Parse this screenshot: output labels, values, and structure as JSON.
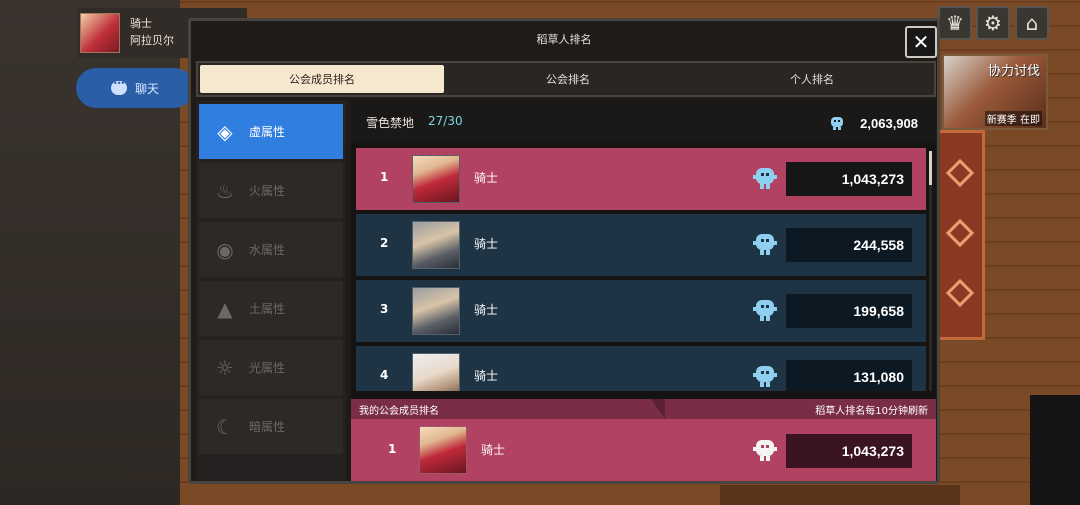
{
  "player": {
    "name": "骑士",
    "guild": "阿拉贝尔"
  },
  "chat": {
    "label": "聊天"
  },
  "event": {
    "title": "协力讨伐",
    "subtitle": "新赛季 在即"
  },
  "modal": {
    "title": "稻草人排名",
    "close_symbol": "✕",
    "tabs": [
      {
        "label": "公会成员排名",
        "active": true
      },
      {
        "label": "公会排名",
        "active": false
      },
      {
        "label": "个人排名",
        "active": false
      }
    ]
  },
  "sidebar": {
    "items": [
      {
        "label": "虚属性",
        "icon": "void-element-icon",
        "active": true
      },
      {
        "label": "火属性",
        "icon": "fire-element-icon",
        "active": false
      },
      {
        "label": "水属性",
        "icon": "water-element-icon",
        "active": false
      },
      {
        "label": "土属性",
        "icon": "earth-element-icon",
        "active": false
      },
      {
        "label": "光属性",
        "icon": "light-element-icon",
        "active": false
      },
      {
        "label": "暗属性",
        "icon": "dark-element-icon",
        "active": false
      }
    ]
  },
  "guild": {
    "name": "雪色禁地",
    "count": "27/30",
    "total": "2,063,908"
  },
  "ranking": {
    "rows": [
      {
        "rank": "1",
        "name": "骑士",
        "score": "1,043,273",
        "highlight": true,
        "avatar": "red"
      },
      {
        "rank": "2",
        "name": "骑士",
        "score": "244,558",
        "highlight": false,
        "avatar": "gray"
      },
      {
        "rank": "3",
        "name": "骑士",
        "score": "199,658",
        "highlight": false,
        "avatar": "gray"
      },
      {
        "rank": "4",
        "name": "骑士",
        "score": "131,080",
        "highlight": false,
        "avatar": "white"
      }
    ]
  },
  "my_rank": {
    "header": "我的公会成员排名",
    "refresh_note": "稻草人排名每10分钟刷新",
    "rank": "1",
    "name": "骑士",
    "score": "1,043,273"
  },
  "colors": {
    "accent_blue": "#2f7ee0",
    "highlight_pink": "#b14262",
    "row_dark_blue": "#1e3445",
    "count_cyan": "#7ad4e6"
  }
}
